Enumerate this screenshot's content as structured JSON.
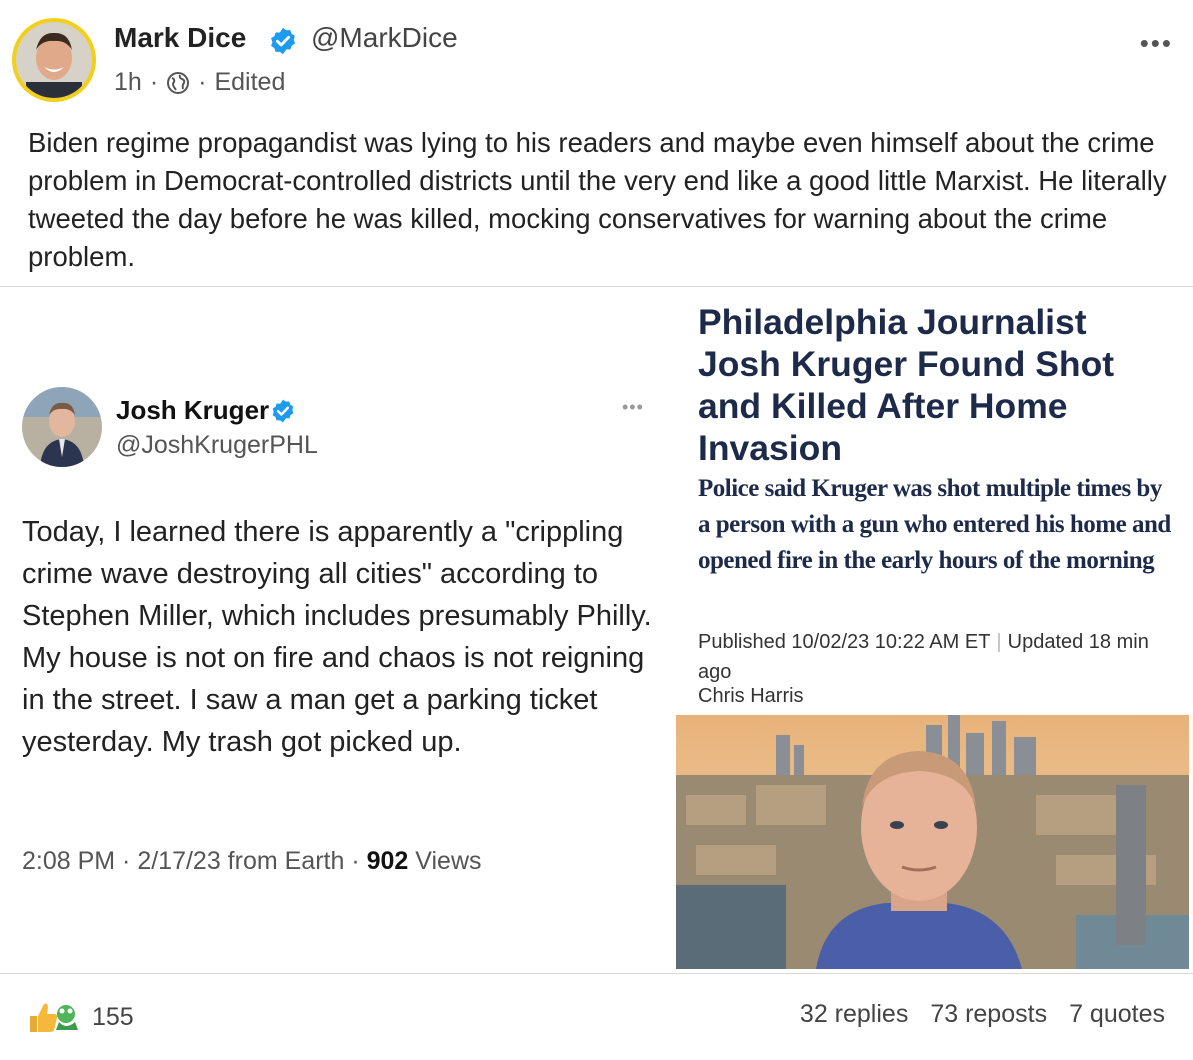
{
  "post": {
    "author_name": "Mark Dice",
    "handle": "@MarkDice",
    "time": "1h",
    "edited": "Edited",
    "text": "Biden regime propagandist was lying to his readers and maybe even himself about the crime problem in Democrat-controlled districts until the very end like a good little Marxist. He literally tweeted the day before he was killed, mocking conservatives for warning about the crime problem."
  },
  "embedded_tweet": {
    "name": "Josh Kruger",
    "handle": "@JoshKrugerPHL",
    "text": "Today, I learned there is apparently a \"crippling crime wave destroying all cities\" according to Stephen Miller, which includes presumably Philly. My house is not on fire and chaos is not reigning in the street. I saw a man get a parking ticket yesterday. My trash got picked up.",
    "footer_time": "2:08 PM · 2/17/23 from Earth · ",
    "views_count": "902",
    "views_label": " Views"
  },
  "article": {
    "headline": "Philadelphia Journalist Josh Kruger Found Shot and Killed After Home Invasion",
    "dek": "Police said Kruger was shot multiple times by a person with a gun who entered his home and opened fire in the early hours of the morning",
    "published": "Published 10/02/23 10:22 AM ET",
    "updated": "Updated 18 min ago",
    "byline": "Chris Harris"
  },
  "footer": {
    "reaction_count": "155",
    "replies": "32 replies",
    "reposts": "73 reposts",
    "quotes": "7 quotes"
  },
  "icons": {
    "verified": "verified-badge-icon",
    "globe": "globe-icon",
    "more": "more-options-icon",
    "reactions": "thumbs-up-icon"
  },
  "colors": {
    "verified_blue": "#1d9bf0",
    "avatar_ring": "#f2cf1c",
    "headline_navy": "#1e2a4a"
  }
}
